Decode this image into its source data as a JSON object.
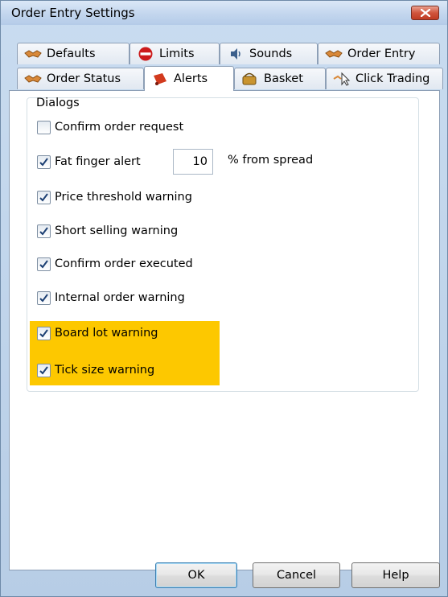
{
  "window": {
    "title": "Order Entry Settings",
    "close_icon": "close-icon"
  },
  "tabs_back_row": [
    {
      "label": "Defaults",
      "icon": "handshake-icon"
    },
    {
      "label": "Limits",
      "icon": "no-entry-icon"
    },
    {
      "label": "Sounds",
      "icon": "speaker-icon"
    },
    {
      "label": "Order Entry",
      "icon": "handshake-icon"
    }
  ],
  "tabs_front_row": [
    {
      "label": "Order Status",
      "icon": "handshake-icon",
      "active": false
    },
    {
      "label": "Alerts",
      "icon": "bell-icon",
      "active": true
    },
    {
      "label": "Basket",
      "icon": "basket-icon",
      "active": false
    },
    {
      "label": "Click Trading",
      "icon": "cursor-click-icon",
      "active": false
    }
  ],
  "dialogs": {
    "legend": "Dialogs",
    "options": [
      {
        "label": "Confirm order request",
        "checked": false
      },
      {
        "label": "Fat finger alert",
        "checked": true
      },
      {
        "label": "Price threshold warning",
        "checked": true
      },
      {
        "label": "Short selling warning",
        "checked": true
      },
      {
        "label": "Confirm order executed",
        "checked": true
      },
      {
        "label": "Internal order warning",
        "checked": true
      },
      {
        "label": "Board lot warning",
        "checked": true,
        "highlighted": true
      },
      {
        "label": "Tick size warning",
        "checked": true,
        "highlighted": true
      }
    ],
    "fat_finger_value": "10",
    "fat_finger_suffix": "% from spread"
  },
  "buttons": {
    "ok": "OK",
    "cancel": "Cancel",
    "help": "Help"
  },
  "colors": {
    "highlight": "#fdc800",
    "accent": "#3c7fb1"
  }
}
